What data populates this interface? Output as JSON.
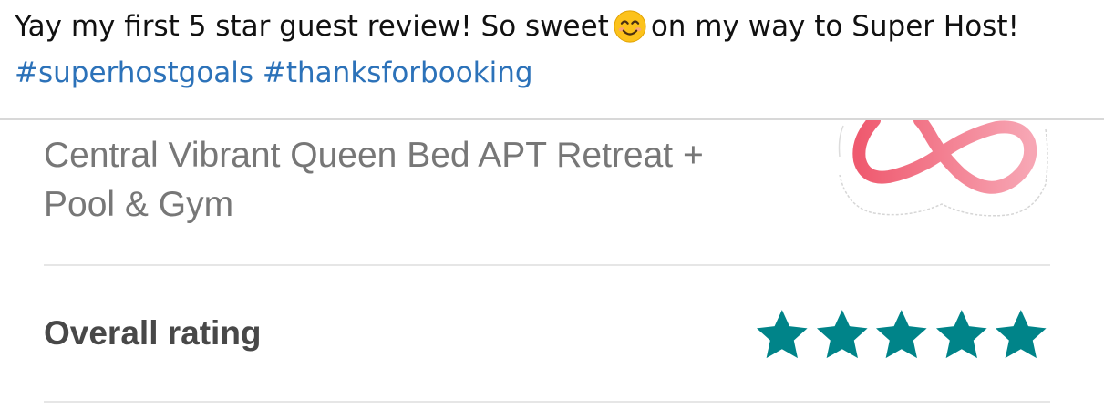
{
  "post": {
    "text_part1": "Yay my first 5 star guest review! So sweet",
    "emoji": "smiling-face-with-smiling-eyes-emoji",
    "text_part2": "on my way to Super Host!",
    "hashtags": [
      "#superhostgoals",
      "#thanksforbooking"
    ]
  },
  "listing": {
    "title_line1": "Central Vibrant Queen Bed APT Retreat +",
    "title_line2": "Pool & Gym",
    "logo": "airbnb-logo"
  },
  "rating": {
    "label": "Overall rating",
    "stars": 5,
    "max_stars": 5,
    "star_color": "#008489"
  },
  "colors": {
    "hashtag": "#2c72b9",
    "logo": "#ff5a5f",
    "label": "#484848",
    "title": "#777777"
  }
}
